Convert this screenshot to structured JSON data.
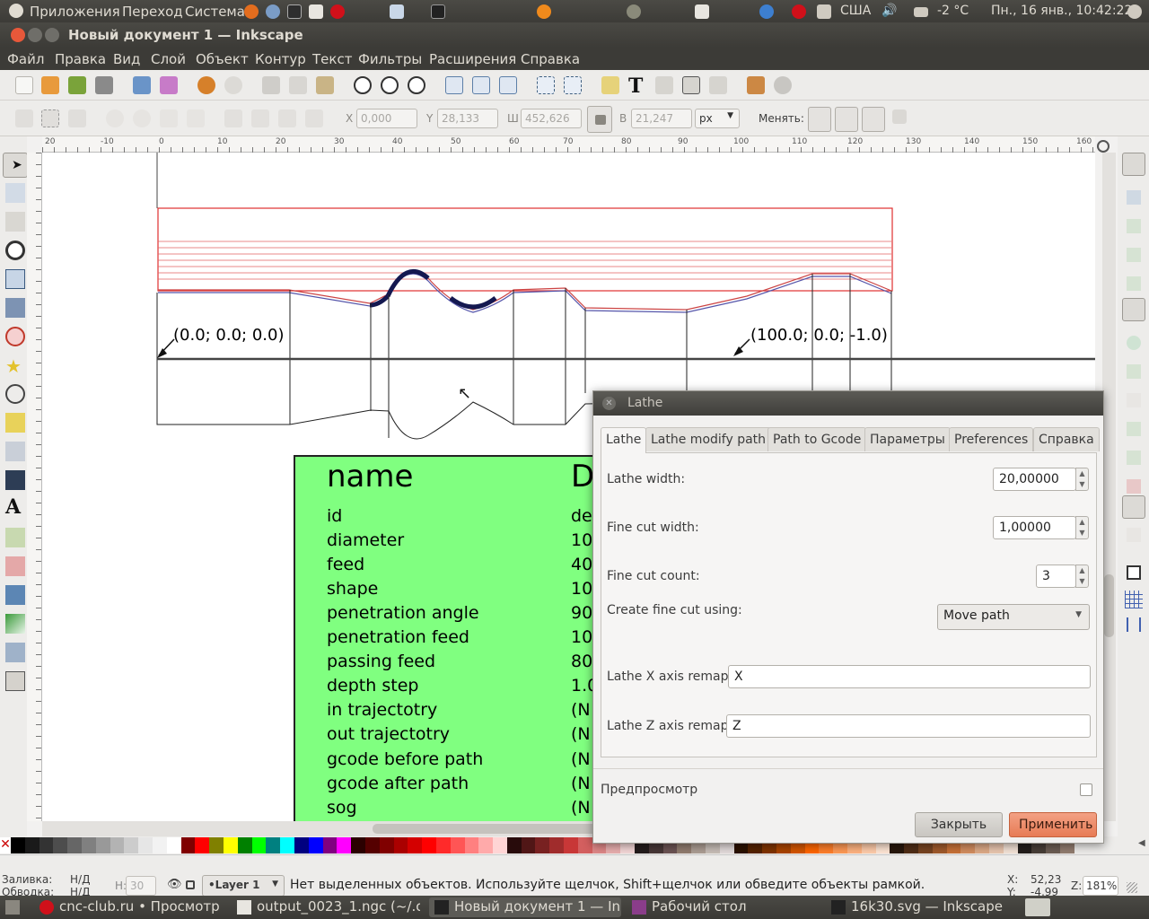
{
  "top_panel": {
    "menus": [
      "Приложения",
      "Переход",
      "Система"
    ],
    "keyboard_layout": "США",
    "weather": "-2 °C",
    "datetime": "Пн., 16 янв., 10:42:22"
  },
  "window": {
    "title": "Новый документ 1 — Inkscape"
  },
  "menubar": [
    "Файл",
    "Правка",
    "Вид",
    "Слой",
    "Объект",
    "Контур",
    "Текст",
    "Фильтры",
    "Расширения",
    "Справка"
  ],
  "controls": {
    "x_label": "X",
    "x_value": "0,000",
    "y_label": "Y",
    "y_value": "28,133",
    "w_label": "Ш",
    "w_value": "452,626",
    "h_label": "В",
    "h_value": "21,247",
    "unit": "px",
    "change_label": "Менять:"
  },
  "ruler_ticks": [
    "20",
    "-10",
    "0",
    "10",
    "20",
    "30",
    "40",
    "50",
    "60",
    "70",
    "80",
    "90",
    "100",
    "110",
    "120",
    "130",
    "140",
    "150",
    "160"
  ],
  "canvas": {
    "point_a": "(0.0; 0.0; 0.0)",
    "point_b": "(100.0; 0.0; -1.0)",
    "table": {
      "header_name": "name",
      "header_default": "D",
      "rows": [
        {
          "name": "id",
          "value": "de"
        },
        {
          "name": "diameter",
          "value": "10"
        },
        {
          "name": "feed",
          "value": "40"
        },
        {
          "name": "shape",
          "value": "10"
        },
        {
          "name": "penetration angle",
          "value": "90"
        },
        {
          "name": "penetration feed",
          "value": "10"
        },
        {
          "name": "passing feed",
          "value": "80"
        },
        {
          "name": "depth step",
          "value": "1.0"
        },
        {
          "name": "in trajectotry",
          "value": "(N"
        },
        {
          "name": "out trajectotry",
          "value": "(N"
        },
        {
          "name": "gcode before path",
          "value": "(N"
        },
        {
          "name": "gcode after path",
          "value": "(N"
        },
        {
          "name": "sog",
          "value": "(N"
        }
      ]
    }
  },
  "dialog": {
    "title": "Lathe",
    "tabs": [
      "Lathe",
      "Lathe modify path",
      "Path to Gcode",
      "Параметры",
      "Preferences",
      "Справка"
    ],
    "lathe_width_label": "Lathe width:",
    "lathe_width_value": "20,00000",
    "fine_cut_width_label": "Fine cut width:",
    "fine_cut_width_value": "1,00000",
    "fine_cut_count_label": "Fine cut count:",
    "fine_cut_count_value": "3",
    "create_fine_cut_label": "Create fine cut using:",
    "create_fine_cut_value": "Move path",
    "x_remap_label": "Lathe X axis remap:",
    "x_remap_value": "X",
    "z_remap_label": "Lathe Z axis remap:",
    "z_remap_value": "Z",
    "preview_label": "Предпросмотр",
    "close_label": "Закрыть",
    "apply_label": "Применить"
  },
  "status": {
    "fill_label": "Заливка:",
    "fill_value": "Н/Д",
    "stroke_label": "Обводка:",
    "stroke_value": "Н/Д",
    "h_label": "Н:",
    "h_value": "30",
    "layer": "•Layer 1",
    "message": "Нет выделенных объектов. Используйте щелчок, Shift+щелчок или обведите объекты рамкой.",
    "x_coord_label": "X:",
    "x_coord": "52,23",
    "y_coord_label": "Y:",
    "y_coord": "-4,99",
    "zoom_label": "Z:",
    "zoom": "181%"
  },
  "taskbar": [
    "cnc-club.ru • Просмотр т...",
    "output_0023_1.ngc (~/.o...",
    "Новый документ 1 — In...",
    "Рабочий стол",
    "16k30.svg — Inkscape"
  ],
  "palette_colors": [
    "#000000",
    "#1a1a1a",
    "#333333",
    "#4d4d4d",
    "#666666",
    "#808080",
    "#999999",
    "#b3b3b3",
    "#cccccc",
    "#e6e6e6",
    "#f2f2f2",
    "#ffffff",
    "#800000",
    "#ff0000",
    "#808000",
    "#ffff00",
    "#008000",
    "#00ff00",
    "#008080",
    "#00ffff",
    "#000080",
    "#0000ff",
    "#800080",
    "#ff00ff",
    "#2b0000",
    "#550000",
    "#800000",
    "#aa0000",
    "#d40000",
    "#ff0000",
    "#ff2a2a",
    "#ff5555",
    "#ff8080",
    "#ffaaaa",
    "#ffd5d5",
    "#280b0b",
    "#501616",
    "#782121",
    "#a02c2c",
    "#c83737",
    "#d35f5f",
    "#de8787",
    "#e9afaf",
    "#f4d7d7",
    "#241c1c",
    "#483737",
    "#6c5353",
    "#917c6f",
    "#ac9d93",
    "#c8beb7",
    "#e3dbdb",
    "#2b1100",
    "#552200",
    "#803300",
    "#aa4400",
    "#d45500",
    "#ff6600",
    "#ff7f2a",
    "#ff9955",
    "#ffb380",
    "#ffccaa",
    "#ffe6d5",
    "#28170b",
    "#502d16",
    "#784421",
    "#a05a2c",
    "#c87137",
    "#d38d5f",
    "#deaa87",
    "#e9c6af",
    "#f4e3d7",
    "#241f1c",
    "#483e37",
    "#6c5d53",
    "#917c6f"
  ]
}
